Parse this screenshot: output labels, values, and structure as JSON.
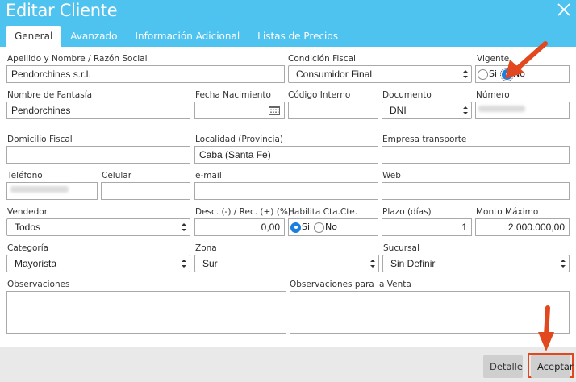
{
  "window": {
    "title": "Editar Cliente"
  },
  "tabs": [
    {
      "label": "General",
      "active": true
    },
    {
      "label": "Avanzado"
    },
    {
      "label": "Información Adicional"
    },
    {
      "label": "Listas de Precios"
    }
  ],
  "form": {
    "apellido_nombre": {
      "label": "Apellido y Nombre / Razón Social",
      "value": "Pendorchines s.r.l."
    },
    "condicion_fiscal": {
      "label": "Condición Fiscal",
      "value": "Consumidor Final"
    },
    "vigente": {
      "label": "Vigente",
      "options": [
        "Si",
        "No"
      ],
      "selected": "No"
    },
    "nombre_fantasia": {
      "label": "Nombre de Fantasía",
      "value": "Pendorchines"
    },
    "fecha_nacimiento": {
      "label": "Fecha Nacimiento",
      "value": ""
    },
    "codigo_interno": {
      "label": "Código Interno",
      "value": ""
    },
    "documento": {
      "label": "Documento",
      "value": "DNI"
    },
    "numero": {
      "label": "Número",
      "value": ""
    },
    "domicilio_fiscal": {
      "label": "Domicilio Fiscal",
      "value": ""
    },
    "localidad": {
      "label": "Localidad (Provincia)",
      "value": "Caba (Santa Fe)"
    },
    "empresa_transporte": {
      "label": "Empresa transporte",
      "value": ""
    },
    "telefono": {
      "label": "Teléfono",
      "value": ""
    },
    "celular": {
      "label": "Celular",
      "value": ""
    },
    "email": {
      "label": "e-mail",
      "value": ""
    },
    "web": {
      "label": "Web",
      "value": ""
    },
    "vendedor": {
      "label": "Vendedor",
      "value": "Todos"
    },
    "desc_rec": {
      "label": "Desc. (-) / Rec. (+) (%)",
      "value": "0,00"
    },
    "habilita_cta": {
      "label": "Habilita Cta.Cte.",
      "options": [
        "Si",
        "No"
      ],
      "selected": "Si"
    },
    "plazo": {
      "label": "Plazo (días)",
      "value": "1"
    },
    "monto_maximo": {
      "label": "Monto Máximo",
      "value": "2.000.000,00"
    },
    "categoria": {
      "label": "Categoría",
      "value": "Mayorista"
    },
    "zona": {
      "label": "Zona",
      "value": "Sur"
    },
    "sucursal": {
      "label": "Sucursal",
      "value": "Sin Definir"
    },
    "observaciones": {
      "label": "Observaciones",
      "value": ""
    },
    "observaciones_venta": {
      "label": "Observaciones para la Venta",
      "value": ""
    }
  },
  "footer": {
    "detalle_label": "Detalle",
    "aceptar_label": "Aceptar"
  },
  "colors": {
    "header": "#4fc3ef",
    "radio_selected": "#1a7fe0",
    "annotation": "#e2481f",
    "footer": "#e9e9e9"
  }
}
